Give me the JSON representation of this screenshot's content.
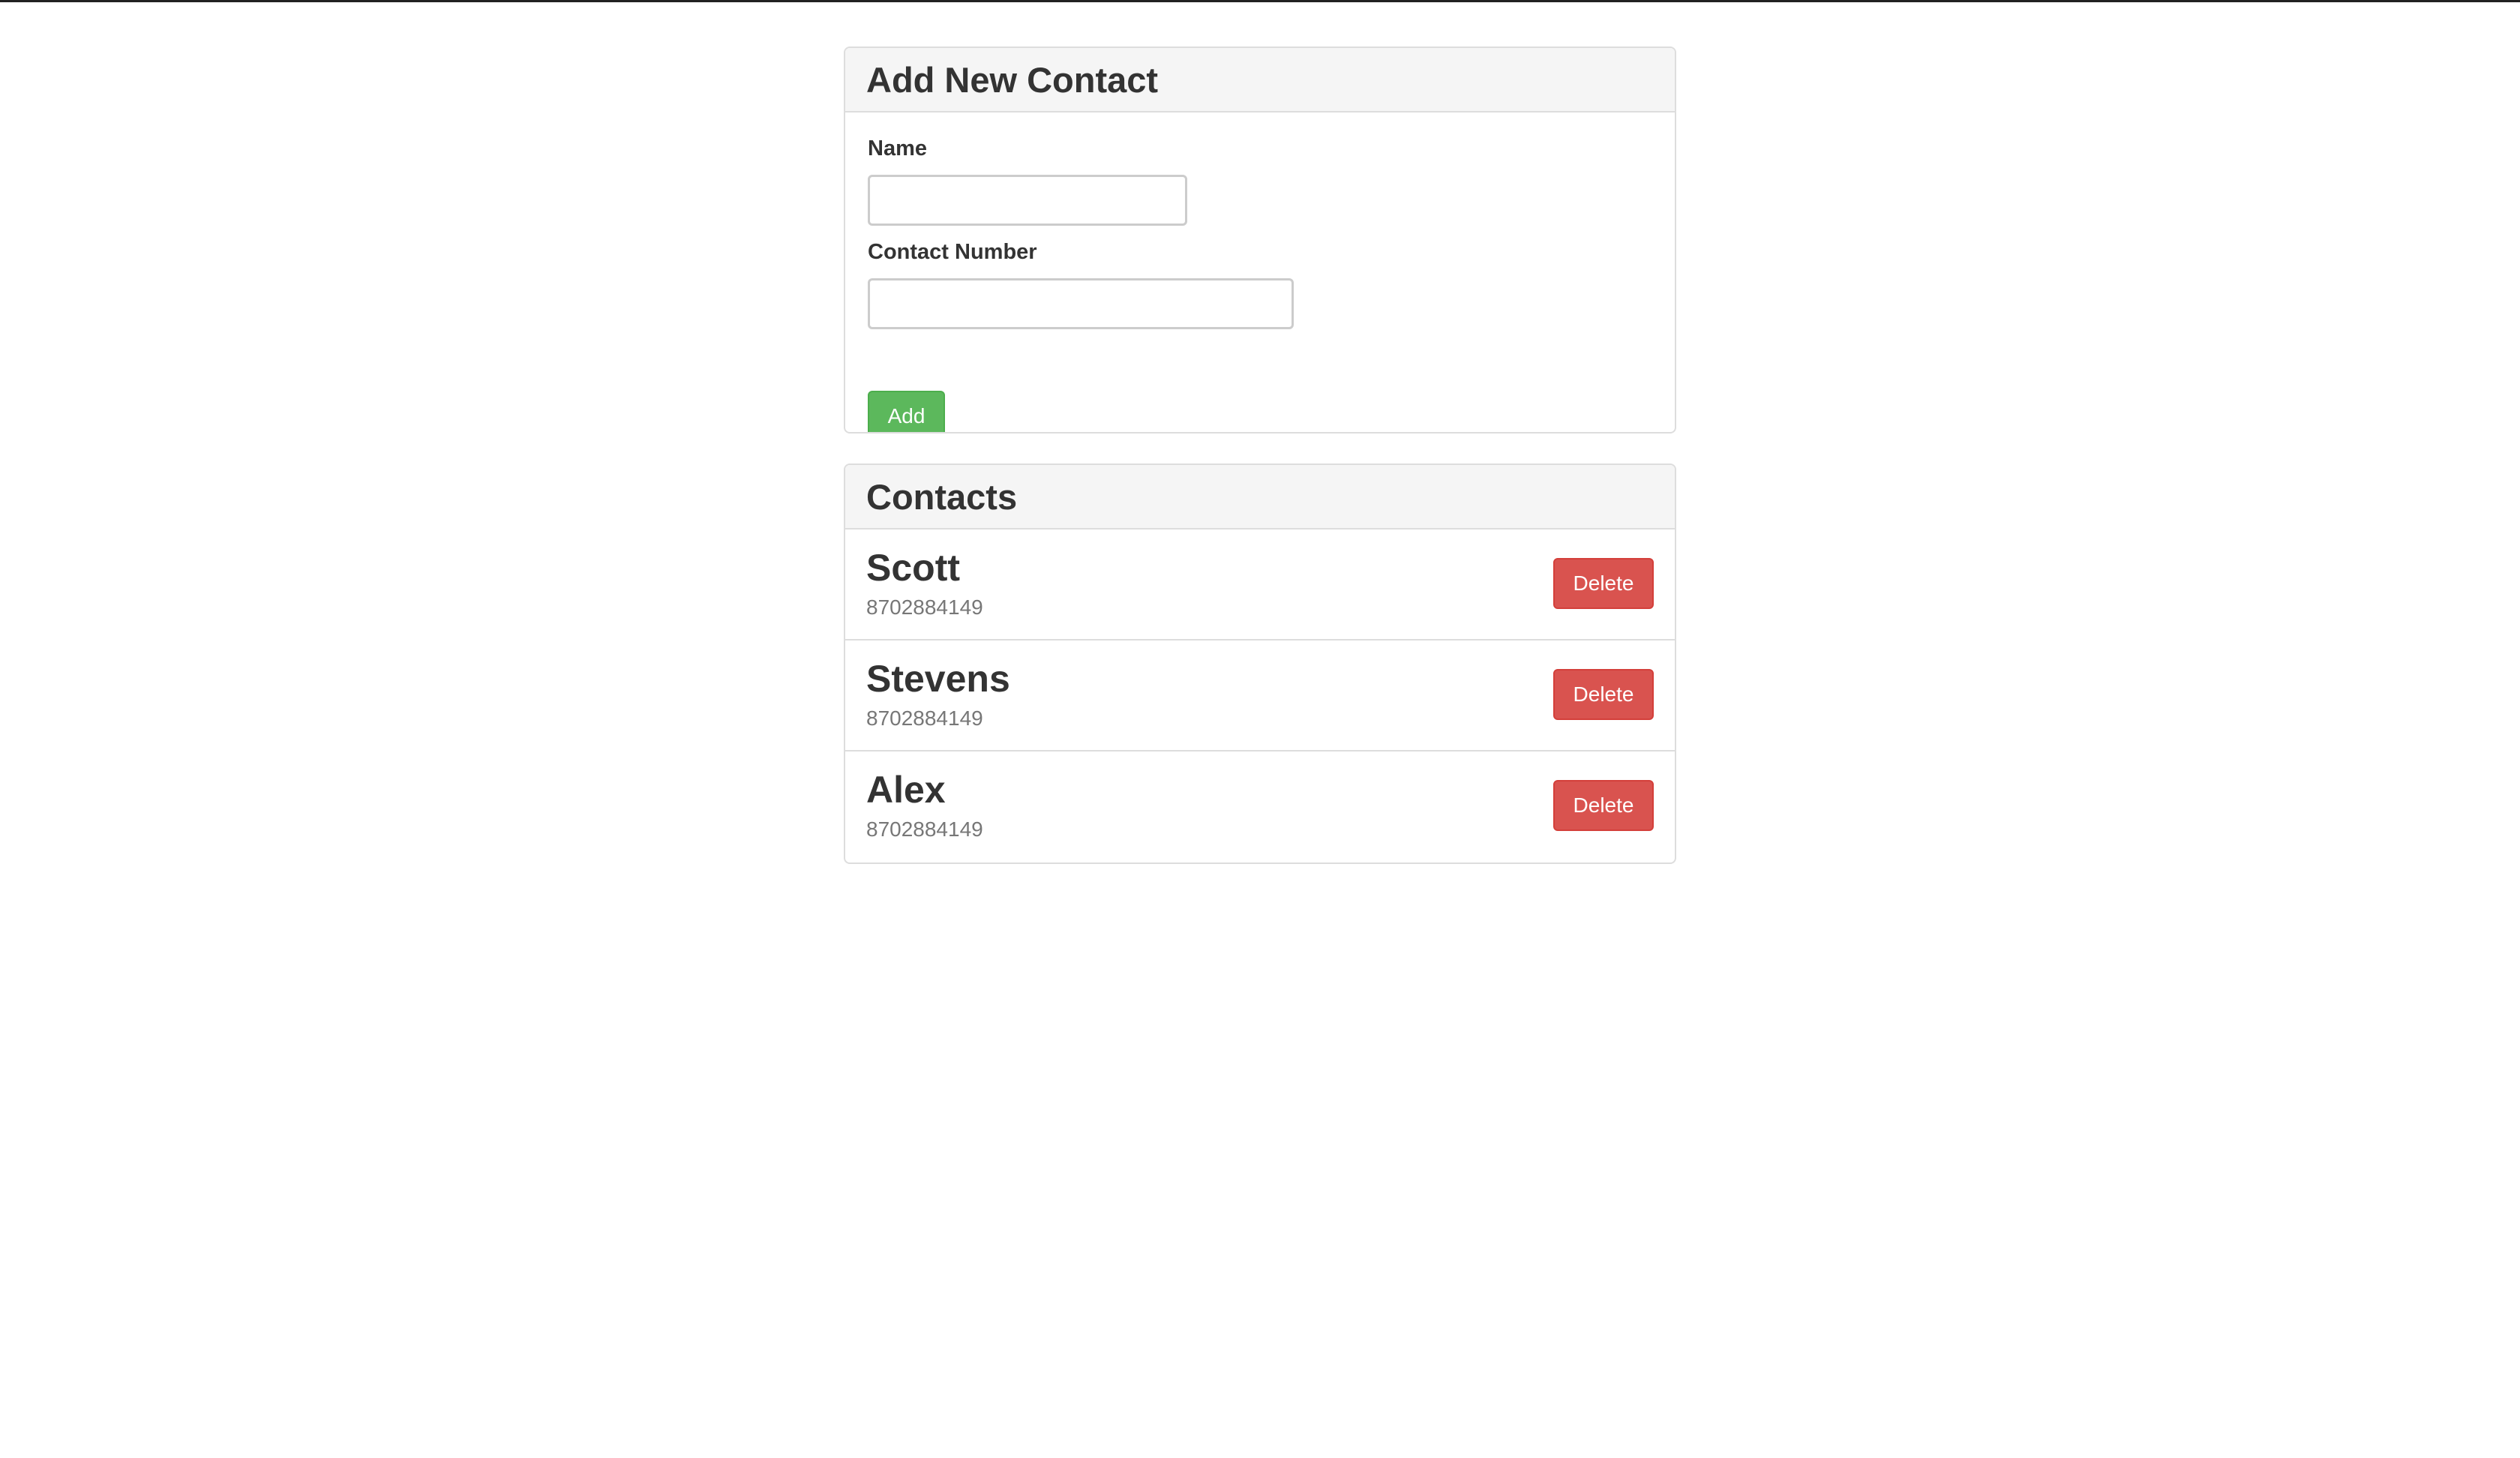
{
  "add_panel": {
    "title": "Add New Contact",
    "name_label": "Name",
    "name_value": "",
    "number_label": "Contact Number",
    "number_value": "",
    "add_button": "Add"
  },
  "contacts_panel": {
    "title": "Contacts",
    "items": [
      {
        "name": "Scott",
        "number": "8702884149",
        "delete_label": "Delete"
      },
      {
        "name": "Stevens",
        "number": "8702884149",
        "delete_label": "Delete"
      },
      {
        "name": "Alex",
        "number": "8702884149",
        "delete_label": "Delete"
      }
    ]
  },
  "colors": {
    "add_button": "#5cb85c",
    "delete_button": "#d9534f",
    "panel_heading_bg": "#f5f5f5",
    "border": "#dddddd"
  }
}
